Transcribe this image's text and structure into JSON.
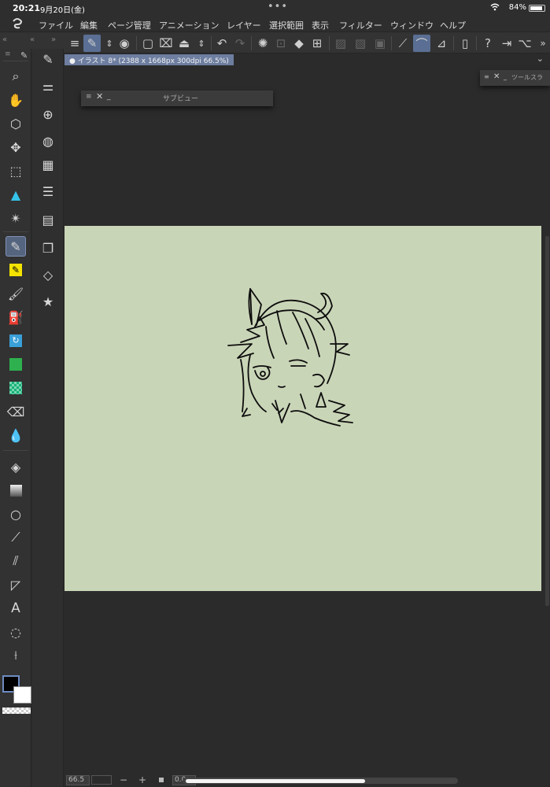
{
  "status_bar": {
    "time": "20:21",
    "date": "9月20日(金)",
    "battery": "84%"
  },
  "menu": {
    "items": [
      "ファイル",
      "編集",
      "ページ管理",
      "アニメーション",
      "レイヤー",
      "選択範囲",
      "表示",
      "フィルター",
      "ウィンドウ",
      "ヘルプ"
    ]
  },
  "document": {
    "tab_title": "イラスト 8* (2388 x 1668px 300dpi 66.5%)",
    "canvas_color": "#c9d5b7"
  },
  "palettes": {
    "sub_view": "サブビュー",
    "tool_slider": "ツールスラ"
  },
  "bottom_bar": {
    "zoom": "66.5",
    "minus": "−",
    "plus": "+",
    "angle": "0.0"
  },
  "colors": {
    "main": "#000000",
    "sub": "#ffffff",
    "accent": "#5a6f93"
  }
}
